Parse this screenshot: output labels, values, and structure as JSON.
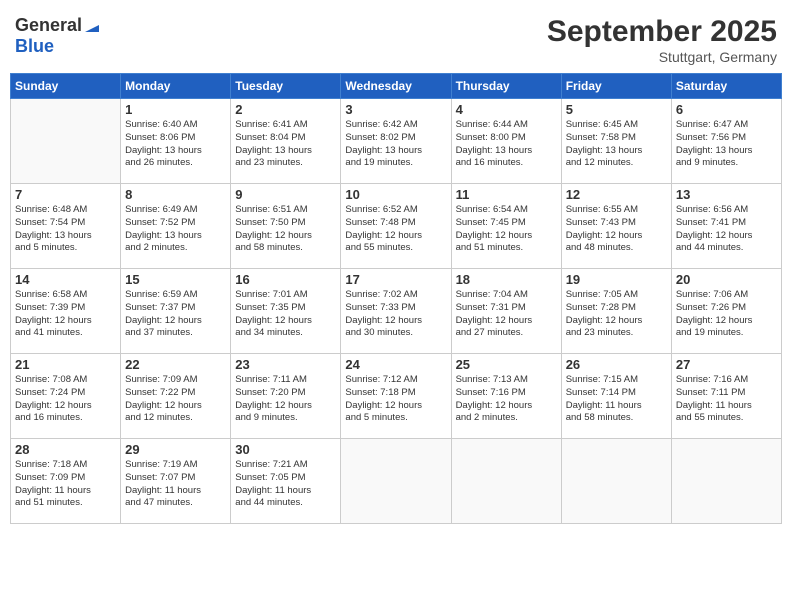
{
  "header": {
    "logo_general": "General",
    "logo_blue": "Blue",
    "month_title": "September 2025",
    "location": "Stuttgart, Germany"
  },
  "days_of_week": [
    "Sunday",
    "Monday",
    "Tuesday",
    "Wednesday",
    "Thursday",
    "Friday",
    "Saturday"
  ],
  "weeks": [
    [
      {
        "day": "",
        "info": ""
      },
      {
        "day": "1",
        "info": "Sunrise: 6:40 AM\nSunset: 8:06 PM\nDaylight: 13 hours\nand 26 minutes."
      },
      {
        "day": "2",
        "info": "Sunrise: 6:41 AM\nSunset: 8:04 PM\nDaylight: 13 hours\nand 23 minutes."
      },
      {
        "day": "3",
        "info": "Sunrise: 6:42 AM\nSunset: 8:02 PM\nDaylight: 13 hours\nand 19 minutes."
      },
      {
        "day": "4",
        "info": "Sunrise: 6:44 AM\nSunset: 8:00 PM\nDaylight: 13 hours\nand 16 minutes."
      },
      {
        "day": "5",
        "info": "Sunrise: 6:45 AM\nSunset: 7:58 PM\nDaylight: 13 hours\nand 12 minutes."
      },
      {
        "day": "6",
        "info": "Sunrise: 6:47 AM\nSunset: 7:56 PM\nDaylight: 13 hours\nand 9 minutes."
      }
    ],
    [
      {
        "day": "7",
        "info": "Sunrise: 6:48 AM\nSunset: 7:54 PM\nDaylight: 13 hours\nand 5 minutes."
      },
      {
        "day": "8",
        "info": "Sunrise: 6:49 AM\nSunset: 7:52 PM\nDaylight: 13 hours\nand 2 minutes."
      },
      {
        "day": "9",
        "info": "Sunrise: 6:51 AM\nSunset: 7:50 PM\nDaylight: 12 hours\nand 58 minutes."
      },
      {
        "day": "10",
        "info": "Sunrise: 6:52 AM\nSunset: 7:48 PM\nDaylight: 12 hours\nand 55 minutes."
      },
      {
        "day": "11",
        "info": "Sunrise: 6:54 AM\nSunset: 7:45 PM\nDaylight: 12 hours\nand 51 minutes."
      },
      {
        "day": "12",
        "info": "Sunrise: 6:55 AM\nSunset: 7:43 PM\nDaylight: 12 hours\nand 48 minutes."
      },
      {
        "day": "13",
        "info": "Sunrise: 6:56 AM\nSunset: 7:41 PM\nDaylight: 12 hours\nand 44 minutes."
      }
    ],
    [
      {
        "day": "14",
        "info": "Sunrise: 6:58 AM\nSunset: 7:39 PM\nDaylight: 12 hours\nand 41 minutes."
      },
      {
        "day": "15",
        "info": "Sunrise: 6:59 AM\nSunset: 7:37 PM\nDaylight: 12 hours\nand 37 minutes."
      },
      {
        "day": "16",
        "info": "Sunrise: 7:01 AM\nSunset: 7:35 PM\nDaylight: 12 hours\nand 34 minutes."
      },
      {
        "day": "17",
        "info": "Sunrise: 7:02 AM\nSunset: 7:33 PM\nDaylight: 12 hours\nand 30 minutes."
      },
      {
        "day": "18",
        "info": "Sunrise: 7:04 AM\nSunset: 7:31 PM\nDaylight: 12 hours\nand 27 minutes."
      },
      {
        "day": "19",
        "info": "Sunrise: 7:05 AM\nSunset: 7:28 PM\nDaylight: 12 hours\nand 23 minutes."
      },
      {
        "day": "20",
        "info": "Sunrise: 7:06 AM\nSunset: 7:26 PM\nDaylight: 12 hours\nand 19 minutes."
      }
    ],
    [
      {
        "day": "21",
        "info": "Sunrise: 7:08 AM\nSunset: 7:24 PM\nDaylight: 12 hours\nand 16 minutes."
      },
      {
        "day": "22",
        "info": "Sunrise: 7:09 AM\nSunset: 7:22 PM\nDaylight: 12 hours\nand 12 minutes."
      },
      {
        "day": "23",
        "info": "Sunrise: 7:11 AM\nSunset: 7:20 PM\nDaylight: 12 hours\nand 9 minutes."
      },
      {
        "day": "24",
        "info": "Sunrise: 7:12 AM\nSunset: 7:18 PM\nDaylight: 12 hours\nand 5 minutes."
      },
      {
        "day": "25",
        "info": "Sunrise: 7:13 AM\nSunset: 7:16 PM\nDaylight: 12 hours\nand 2 minutes."
      },
      {
        "day": "26",
        "info": "Sunrise: 7:15 AM\nSunset: 7:14 PM\nDaylight: 11 hours\nand 58 minutes."
      },
      {
        "day": "27",
        "info": "Sunrise: 7:16 AM\nSunset: 7:11 PM\nDaylight: 11 hours\nand 55 minutes."
      }
    ],
    [
      {
        "day": "28",
        "info": "Sunrise: 7:18 AM\nSunset: 7:09 PM\nDaylight: 11 hours\nand 51 minutes."
      },
      {
        "day": "29",
        "info": "Sunrise: 7:19 AM\nSunset: 7:07 PM\nDaylight: 11 hours\nand 47 minutes."
      },
      {
        "day": "30",
        "info": "Sunrise: 7:21 AM\nSunset: 7:05 PM\nDaylight: 11 hours\nand 44 minutes."
      },
      {
        "day": "",
        "info": ""
      },
      {
        "day": "",
        "info": ""
      },
      {
        "day": "",
        "info": ""
      },
      {
        "day": "",
        "info": ""
      }
    ]
  ]
}
